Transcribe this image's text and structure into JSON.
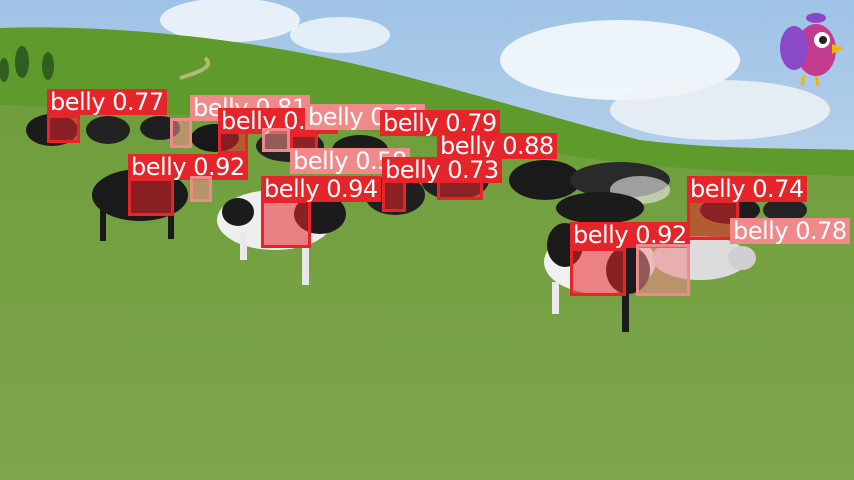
{
  "scene": {
    "description_icons": [
      "cow-herd",
      "grass-field",
      "sky",
      "parrot-logo"
    ],
    "colors": {
      "sky": "#b9d4ea",
      "hill": "#5f9a2c",
      "grass": "#78a446",
      "box_primary": "#e5252a",
      "box_secondary": "#f08a8a"
    }
  },
  "detections": [
    {
      "label": "belly",
      "score": "0.77",
      "color": "#e5252a"
    },
    {
      "label": "belly",
      "score": "0.81",
      "color": "#f08a8a"
    },
    {
      "label": "belly",
      "score": "0.80",
      "color": "#e5252a"
    },
    {
      "label": "belly",
      "score": "0.81",
      "color": "#f08a8a"
    },
    {
      "label": "belly",
      "score": "0.79",
      "color": "#e5252a"
    },
    {
      "label": "belly",
      "score": "0.88",
      "color": "#e5252a"
    },
    {
      "label": "belly",
      "score": "0.92",
      "color": "#e5252a"
    },
    {
      "label": "belly",
      "score": "0.58",
      "color": "#f08a8a"
    },
    {
      "label": "belly",
      "score": "0.73",
      "color": "#e5252a"
    },
    {
      "label": "belly",
      "score": "0.94",
      "color": "#e5252a"
    },
    {
      "label": "belly",
      "score": "0.74",
      "color": "#e5252a"
    },
    {
      "label": "belly",
      "score": "0.92",
      "color": "#e5252a"
    },
    {
      "label": "belly",
      "score": "0.78",
      "color": "#f08a8a"
    }
  ]
}
